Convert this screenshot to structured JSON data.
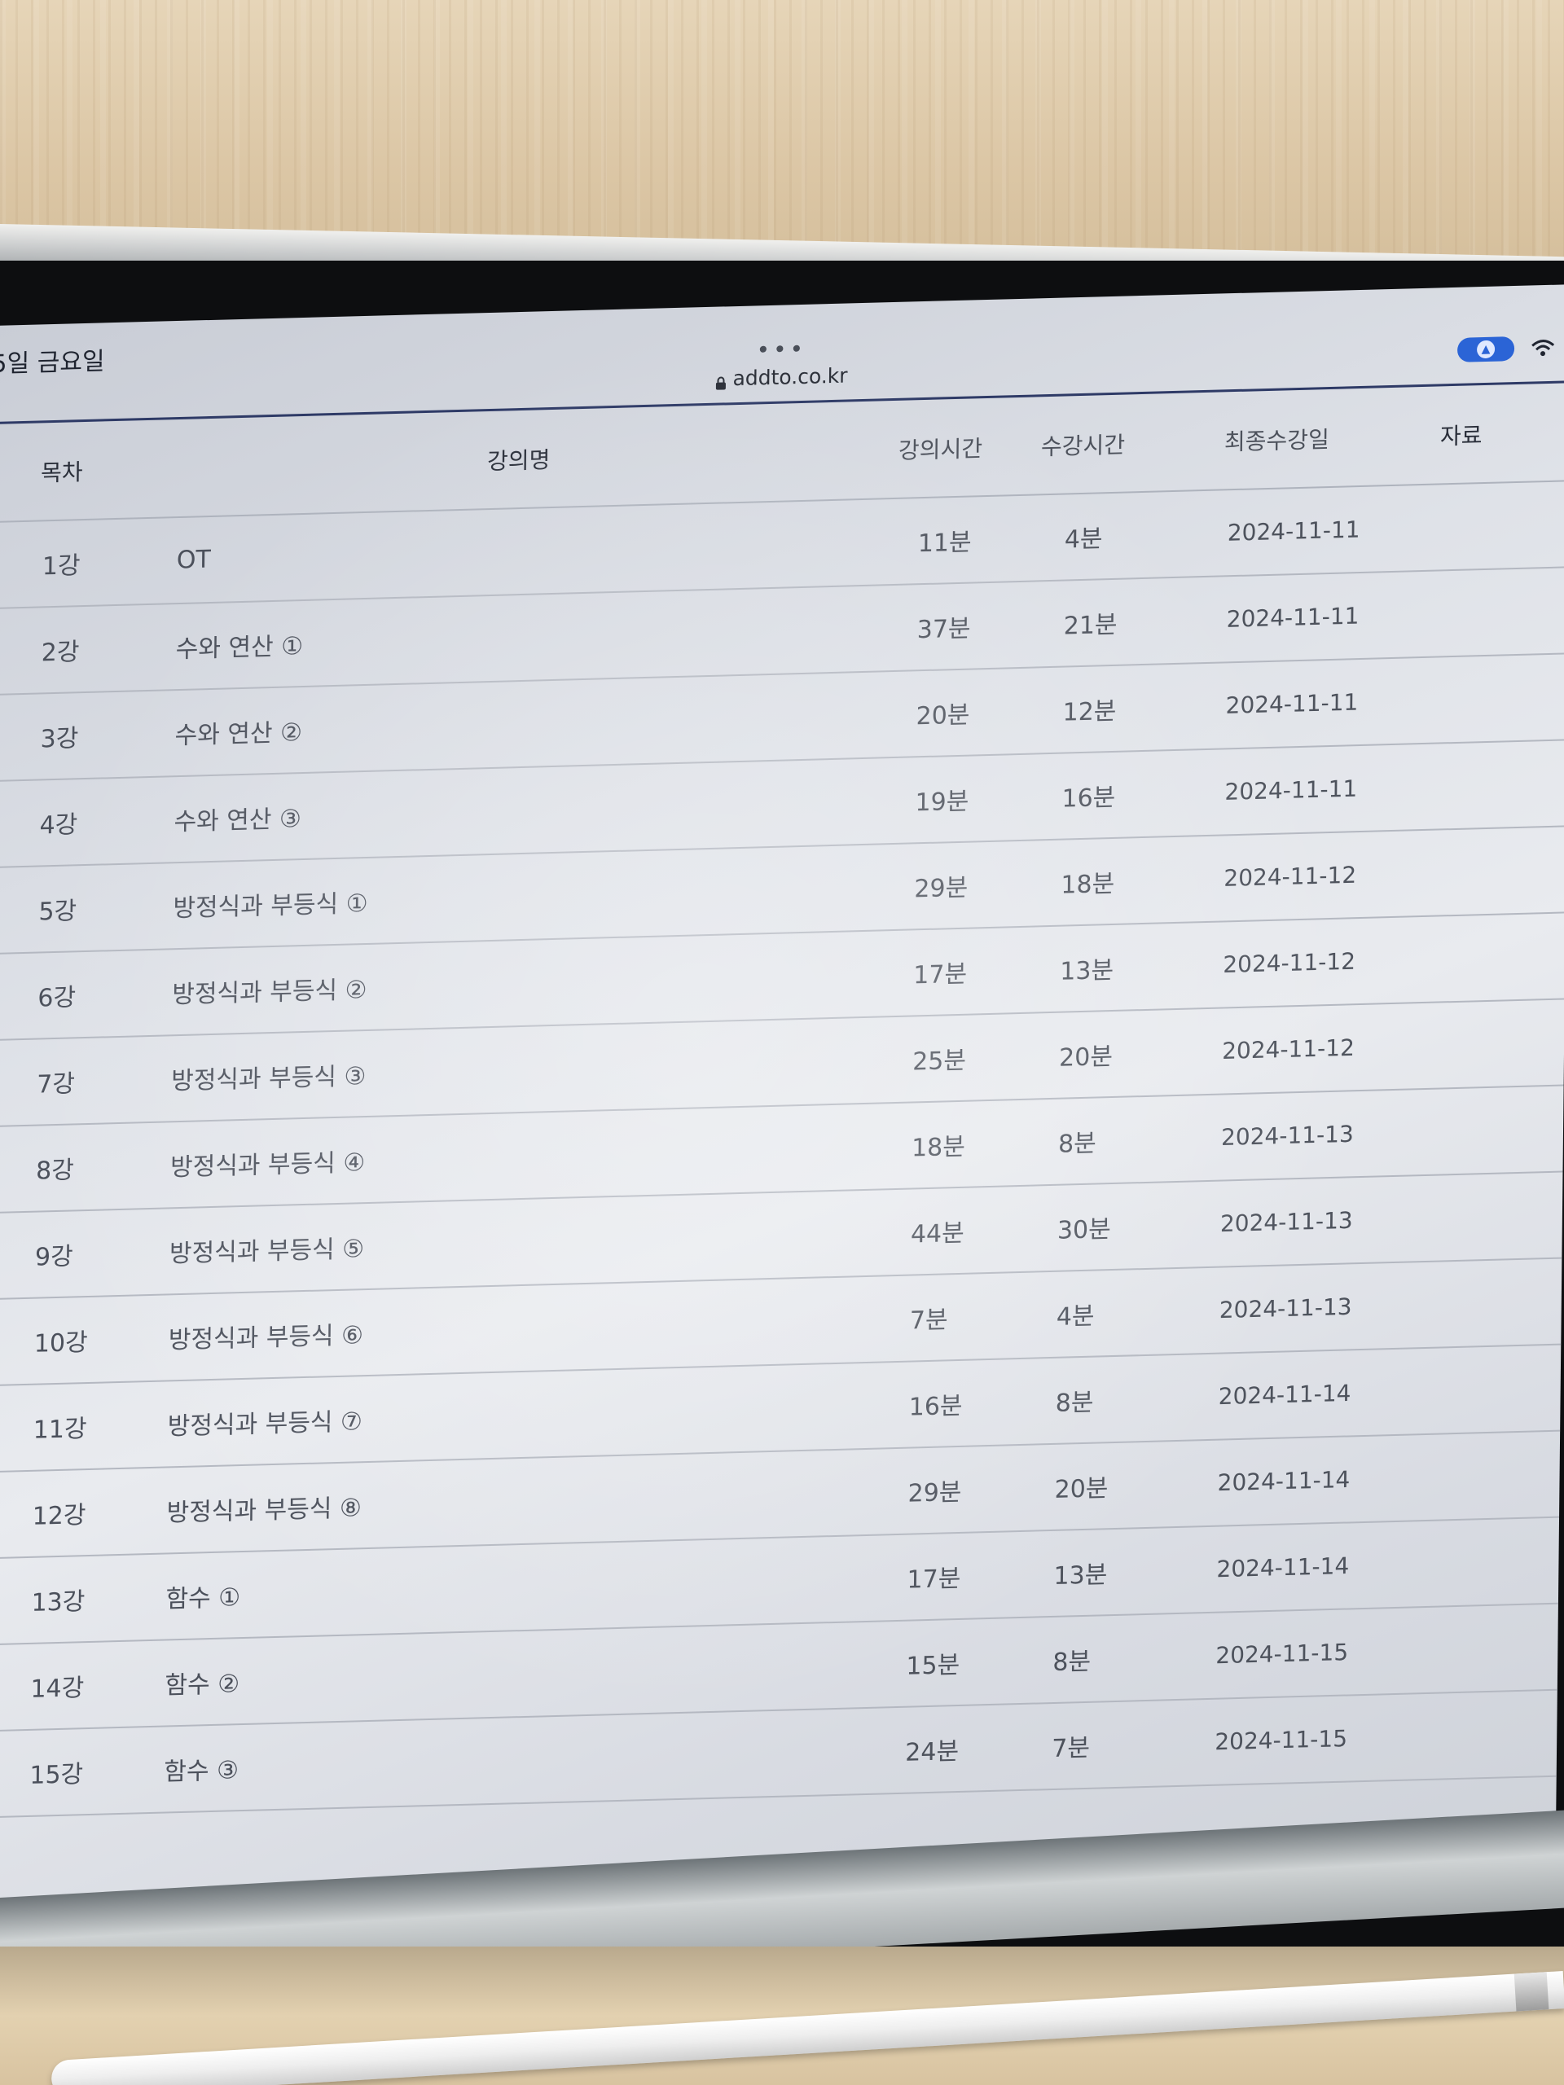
{
  "status_bar": {
    "date": "5일 금요일"
  },
  "browser": {
    "more_dots": "•••",
    "url": "addto.co.kr"
  },
  "table": {
    "headers": {
      "no": "목차",
      "title": "강의명",
      "lecture_time": "강의시간",
      "watched_time": "수강시간",
      "last_date": "최종수강일",
      "materials": "자료"
    },
    "rows": [
      {
        "no": "1강",
        "title": "OT",
        "lecture_time": "11분",
        "watched_time": "4분",
        "last_date": "2024-11-11"
      },
      {
        "no": "2강",
        "title": "수와 연산 ①",
        "lecture_time": "37분",
        "watched_time": "21분",
        "last_date": "2024-11-11"
      },
      {
        "no": "3강",
        "title": "수와 연산 ②",
        "lecture_time": "20분",
        "watched_time": "12분",
        "last_date": "2024-11-11"
      },
      {
        "no": "4강",
        "title": "수와 연산 ③",
        "lecture_time": "19분",
        "watched_time": "16분",
        "last_date": "2024-11-11"
      },
      {
        "no": "5강",
        "title": "방정식과 부등식 ①",
        "lecture_time": "29분",
        "watched_time": "18분",
        "last_date": "2024-11-12"
      },
      {
        "no": "6강",
        "title": "방정식과 부등식 ②",
        "lecture_time": "17분",
        "watched_time": "13분",
        "last_date": "2024-11-12"
      },
      {
        "no": "7강",
        "title": "방정식과 부등식 ③",
        "lecture_time": "25분",
        "watched_time": "20분",
        "last_date": "2024-11-12"
      },
      {
        "no": "8강",
        "title": "방정식과 부등식 ④",
        "lecture_time": "18분",
        "watched_time": "8분",
        "last_date": "2024-11-13"
      },
      {
        "no": "9강",
        "title": "방정식과 부등식 ⑤",
        "lecture_time": "44분",
        "watched_time": "30분",
        "last_date": "2024-11-13"
      },
      {
        "no": "10강",
        "title": "방정식과 부등식 ⑥",
        "lecture_time": "7분",
        "watched_time": "4분",
        "last_date": "2024-11-13"
      },
      {
        "no": "11강",
        "title": "방정식과 부등식 ⑦",
        "lecture_time": "16분",
        "watched_time": "8분",
        "last_date": "2024-11-14"
      },
      {
        "no": "12강",
        "title": "방정식과 부등식 ⑧",
        "lecture_time": "29분",
        "watched_time": "20분",
        "last_date": "2024-11-14"
      },
      {
        "no": "13강",
        "title": "함수 ①",
        "lecture_time": "17분",
        "watched_time": "13분",
        "last_date": "2024-11-14"
      },
      {
        "no": "14강",
        "title": "함수 ②",
        "lecture_time": "15분",
        "watched_time": "8분",
        "last_date": "2024-11-15"
      },
      {
        "no": "15강",
        "title": "함수 ③",
        "lecture_time": "24분",
        "watched_time": "7분",
        "last_date": "2024-11-15"
      }
    ]
  },
  "colors": {
    "accent_rule": "#2e3a66",
    "toggle_pill": "#2b64d6"
  }
}
